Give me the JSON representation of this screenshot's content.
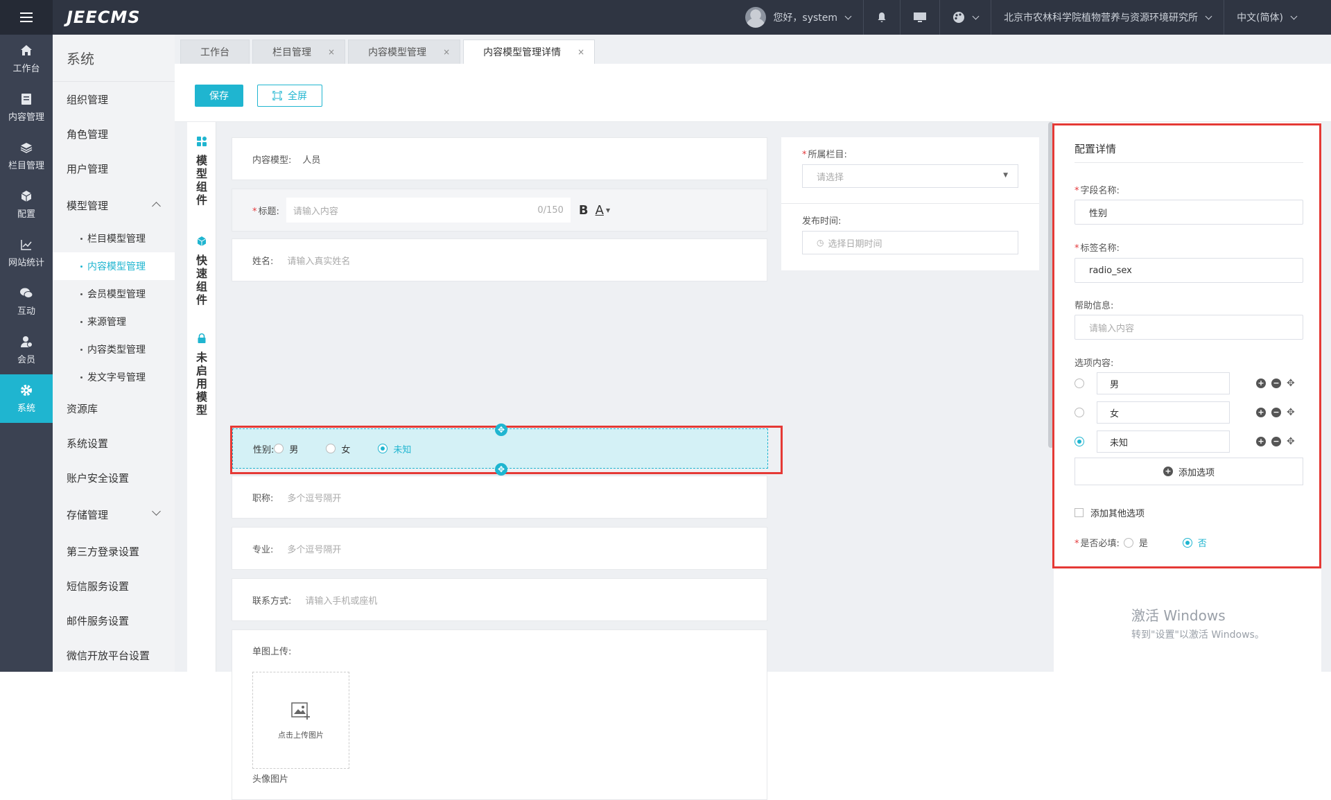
{
  "app": {
    "logo": "JEECMS"
  },
  "header": {
    "greeting": "您好，system",
    "org": "北京市农林科学院植物营养与资源环境研究所",
    "language": "中文(简体)"
  },
  "rail": [
    {
      "label": "工作台",
      "icon": "home-icon"
    },
    {
      "label": "内容管理",
      "icon": "document-icon"
    },
    {
      "label": "栏目管理",
      "icon": "layers-icon"
    },
    {
      "label": "配置",
      "icon": "cube-icon"
    },
    {
      "label": "网站统计",
      "icon": "chart-icon"
    },
    {
      "label": "互动",
      "icon": "chat-icon"
    },
    {
      "label": "会员",
      "icon": "member-icon"
    },
    {
      "label": "系统",
      "icon": "gear-icon",
      "active": true
    }
  ],
  "menu": {
    "title": "系统",
    "items": [
      "组织管理",
      "角色管理",
      "用户管理",
      "模型管理"
    ],
    "sub": [
      "栏目模型管理",
      "内容模型管理",
      "会员模型管理",
      "来源管理",
      "内容类型管理",
      "发文字号管理"
    ],
    "items2": [
      "资源库",
      "系统设置",
      "账户安全设置",
      "存储管理",
      "第三方登录设置",
      "短信服务设置",
      "邮件服务设置",
      "微信开放平台设置"
    ]
  },
  "tabs": [
    {
      "label": "工作台",
      "closable": false
    },
    {
      "label": "栏目管理",
      "closable": true
    },
    {
      "label": "内容模型管理",
      "closable": true
    },
    {
      "label": "内容模型管理详情",
      "closable": true,
      "active": true
    }
  ],
  "toolbar": {
    "save": "保存",
    "fullscreen": "全屏"
  },
  "components": [
    "模型组件",
    "快速组件",
    "未启用模型"
  ],
  "form": {
    "model_label": "内容模型:",
    "model_value": "人员",
    "title_label": "标题:",
    "title_placeholder": "请输入内容",
    "title_count": "0/150",
    "bold": "B",
    "color": "A",
    "name_label": "姓名:",
    "name_placeholder": "请输入真实姓名",
    "gender_label": "性别:",
    "gender_options": [
      "男",
      "女",
      "未知"
    ],
    "gender_selected": "未知",
    "job_label": "职称:",
    "job_placeholder": "多个逗号隔开",
    "major_label": "专业:",
    "major_placeholder": "多个逗号隔开",
    "contact_label": "联系方式:",
    "contact_placeholder": "请输入手机或座机",
    "upload_label": "单图上传:",
    "upload_btn": "点击上传图片",
    "upload_caption": "头像图片"
  },
  "side_form": {
    "column_label": "所属栏目:",
    "column_placeholder": "请选择",
    "time_label": "发布时间:",
    "time_placeholder": "选择日期时间"
  },
  "config": {
    "title": "配置详情",
    "field_name_label": "字段名称:",
    "field_name_value": "性别",
    "tag_name_label": "标签名称:",
    "tag_name_value": "radio_sex",
    "help_label": "帮助信息:",
    "help_placeholder": "请输入内容",
    "options_label": "选项内容:",
    "options": [
      "男",
      "女",
      "未知"
    ],
    "selected_option": "未知",
    "add_option": "添加选项",
    "add_other": "添加其他选项",
    "required_label": "是否必填:",
    "required_yes": "是",
    "required_no": "否",
    "required_value": "否"
  },
  "watermark": {
    "line1": "激活 Windows",
    "line2": "转到\"设置\"以激活 Windows。"
  },
  "colors": {
    "accent": "#1fb5d0",
    "highlight": "#e53935",
    "topbar": "#2f3542",
    "rail": "#3b4252"
  }
}
